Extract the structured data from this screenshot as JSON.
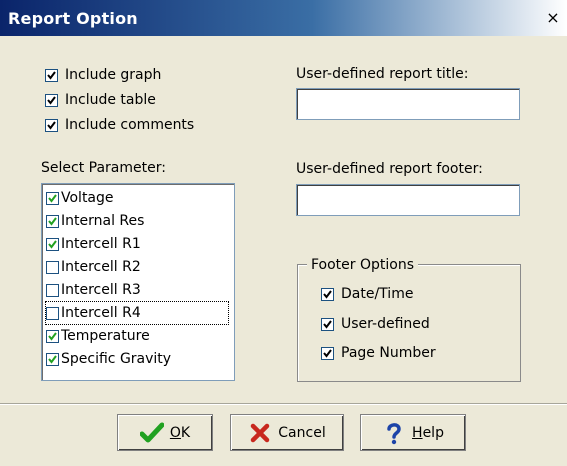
{
  "window": {
    "title": "Report Option",
    "close_label": "×"
  },
  "include": {
    "graph": {
      "label": "Include graph",
      "checked": true
    },
    "table": {
      "label": "Include table",
      "checked": true
    },
    "comments": {
      "label": "Include comments",
      "checked": true
    }
  },
  "report_title": {
    "label": "User-defined report title:",
    "value": ""
  },
  "report_footer": {
    "label": "User-defined report footer:",
    "value": ""
  },
  "parameters": {
    "label": "Select Parameter:",
    "items": [
      {
        "label": "Voltage",
        "checked": true
      },
      {
        "label": "Internal Res",
        "checked": true
      },
      {
        "label": "Intercell R1",
        "checked": true
      },
      {
        "label": "Intercell R2",
        "checked": false
      },
      {
        "label": "Intercell R3",
        "checked": false
      },
      {
        "label": "Intercell R4",
        "checked": false,
        "focused": true
      },
      {
        "label": "Temperature",
        "checked": true
      },
      {
        "label": "Specific Gravity",
        "checked": true
      }
    ]
  },
  "footer_options": {
    "legend": "Footer Options",
    "date_time": {
      "label": "Date/Time",
      "checked": true
    },
    "user_defined": {
      "label": "User-defined",
      "checked": true
    },
    "page_number": {
      "label": "Page Number",
      "checked": true
    }
  },
  "buttons": {
    "ok": {
      "mnemonic": "O",
      "rest": "K",
      "icon": "green-check-icon"
    },
    "cancel": {
      "label": "Cancel",
      "icon": "red-x-icon"
    },
    "help": {
      "mnemonic": "H",
      "rest": "elp",
      "icon": "question-mark-icon"
    }
  },
  "colors": {
    "title_bar": "#0a246a",
    "check_green": "#21a121",
    "cancel_red": "#c8281e",
    "help_blue": "#1d44a8"
  }
}
